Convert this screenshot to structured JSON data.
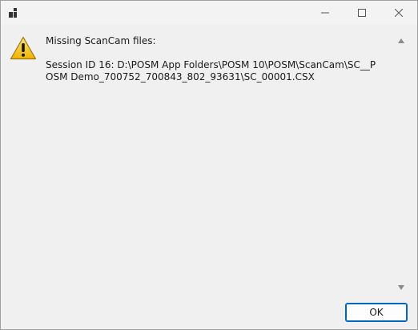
{
  "window": {
    "icons": {
      "app": "app-icon",
      "minimize": "minimize-icon",
      "maximize": "maximize-icon",
      "close": "close-icon"
    }
  },
  "message": {
    "icon": "warning-icon",
    "heading": "Missing ScanCam files:",
    "body": "Session ID 16: D:\\POSM App Folders\\POSM 10\\POSM\\ScanCam\\SC__POSM Demo_700752_700843_802_93631\\SC_00001.CSX"
  },
  "buttons": {
    "ok_label": "OK"
  },
  "colors": {
    "accent": "#0067c0",
    "background": "#f0f0f0",
    "warning_fill": "#f5c211"
  }
}
